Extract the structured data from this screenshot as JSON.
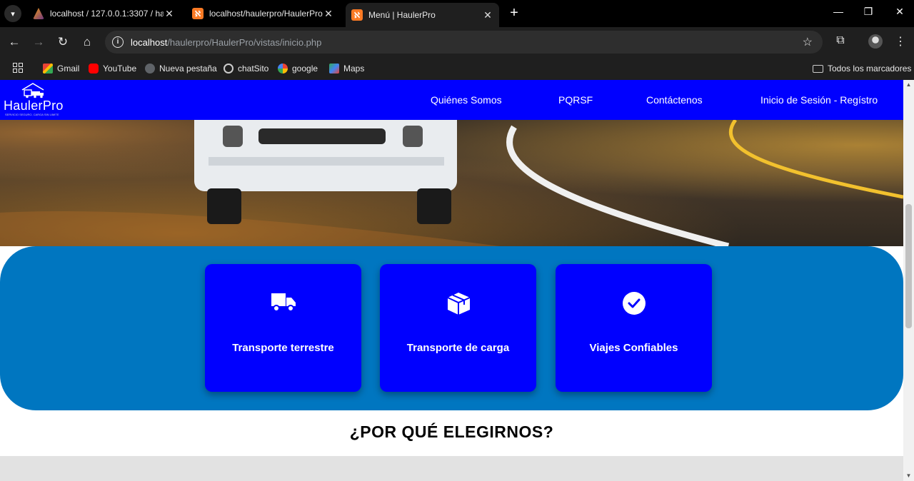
{
  "browser": {
    "tabs": [
      {
        "title": "localhost / 127.0.0.1:3307 / hau",
        "favicon": "phpmyadmin-icon",
        "active": false
      },
      {
        "title": "localhost/haulerpro/HaulerPro/",
        "favicon": "xampp-icon",
        "active": false
      },
      {
        "title": "Menú | HaulerPro",
        "favicon": "xampp-icon",
        "active": true
      }
    ],
    "url_host": "localhost",
    "url_path": "/haulerpro/HaulerPro/vistas/inicio.php",
    "bookmarks": [
      {
        "label": "Gmail",
        "icon": "gmail-icon"
      },
      {
        "label": "YouTube",
        "icon": "youtube-icon"
      },
      {
        "label": "Nueva pestaña",
        "icon": "globe-icon"
      },
      {
        "label": "chatSito",
        "icon": "openai-icon"
      },
      {
        "label": "google",
        "icon": "google-icon"
      },
      {
        "label": "Maps",
        "icon": "maps-icon"
      }
    ],
    "all_bookmarks": "Todos los marcadores"
  },
  "site": {
    "logo_name": "HaulerPro",
    "logo_tagline": "SERVICIO SEGURO, CARGA SIN LIMITE",
    "nav": {
      "about": "Quiénes Somos",
      "pqrsf": "PQRSF",
      "contact": "Contáctenos",
      "login": "Inicio de Sesión - Regístro"
    },
    "accent": "#0000ff",
    "section_bg": "#0076c0",
    "services": [
      {
        "label": "Transporte terrestre",
        "icon": "truck-icon"
      },
      {
        "label": "Transporte de carga",
        "icon": "box-icon"
      },
      {
        "label": "Viajes Confiables",
        "icon": "check-circle-icon"
      }
    ],
    "why_title": "¿POR QUÉ ELEGIRNOS?"
  }
}
